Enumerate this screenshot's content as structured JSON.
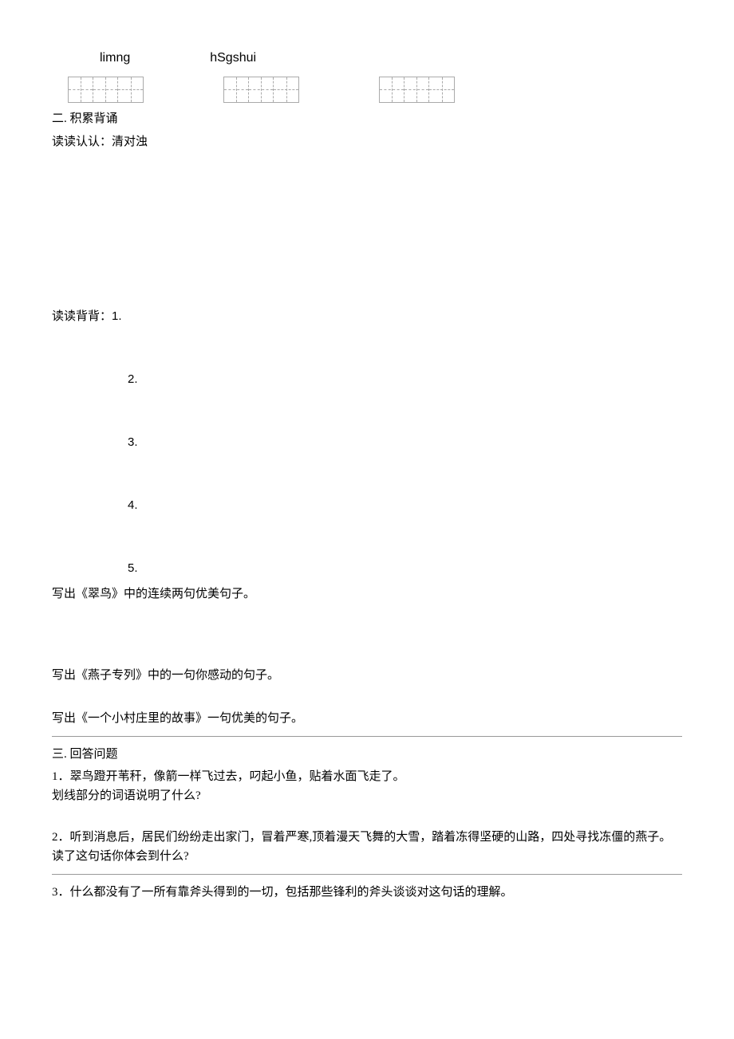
{
  "pinyin": {
    "p1": "limng",
    "p2": "hSgshui"
  },
  "section2": {
    "title": "二. 积累背诵",
    "dudu_renren": "读读认认：清对浊",
    "dudu_beibei_label": "读读背背：",
    "list": {
      "n1": "1.",
      "n2": "2.",
      "n3": "3.",
      "n4": "4.",
      "n5": "5."
    },
    "task_cuiniao": "写出《翠鸟》中的连续两句优美句子。",
    "task_yanzi": "写出《燕子专列》中的一句你感动的句子。",
    "task_xiaocun": "写出《一个小村庄里的故事》一句优美的句子。"
  },
  "section3": {
    "title": "三. 回答问题",
    "q1_line1": "1．翠鸟蹬开苇秆，像箭一样飞过去，叼起小鱼，贴着水面飞走了。",
    "q1_line2": "划线部分的词语说明了什么?",
    "q2_line1": "2．听到消息后，居民们纷纷走出家门，冒着严寒,顶着漫天飞舞的大雪，踏着冻得坚硬的山路，四处寻找冻僵的燕子。",
    "q2_line2": "读了这句话你体会到什么?",
    "q3_line1": "3．什么都没有了一所有靠斧头得到的一切，包括那些锋利的斧头谈谈对这句话的理解。"
  }
}
